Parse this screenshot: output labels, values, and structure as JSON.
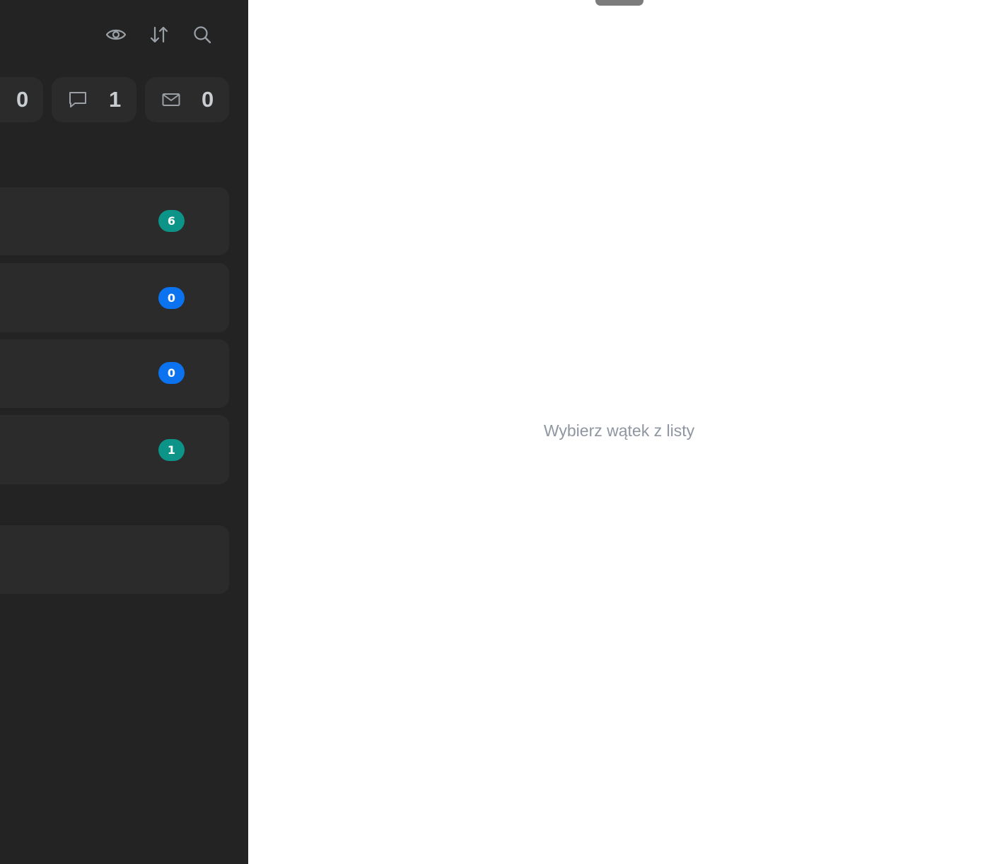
{
  "toolbar": {
    "icons": [
      "eye-icon",
      "sort-arrows-icon",
      "search-icon"
    ]
  },
  "stats": [
    {
      "icon": "partial-hidden",
      "value": "0"
    },
    {
      "icon": "chat-bubble-icon",
      "value": "1"
    },
    {
      "icon": "envelope-icon",
      "value": "0"
    }
  ],
  "threads": [
    {
      "badge": "6",
      "badge_color": "#0d9488"
    },
    {
      "badge": "0",
      "badge_color": "#0b72f0"
    },
    {
      "badge": "0",
      "badge_color": "#0b72f0"
    },
    {
      "badge": "1",
      "badge_color": "#0d9488"
    }
  ],
  "main": {
    "empty_message": "Wybierz wątek z listy"
  },
  "colors": {
    "sidebar_bg": "#232323",
    "card_bg": "#2b2b2b",
    "badge_teal": "#0d9488",
    "badge_blue": "#0b72f0",
    "muted_text": "#8f96a1"
  }
}
